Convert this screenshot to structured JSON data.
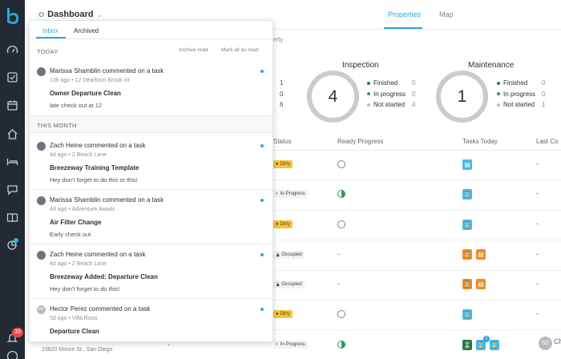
{
  "sidebar": {
    "logo": "breezeway-logo-icon",
    "icons": [
      "speedometer-icon",
      "checkbox-icon",
      "calendar-icon",
      "home-icon",
      "bed-icon",
      "chat-icon",
      "book-icon",
      "pie-chart-icon",
      "bell-icon",
      "help-icon"
    ],
    "notification_count": "33"
  },
  "header": {
    "title": "Dashboard",
    "tabs": [
      {
        "label": "Properties",
        "active": true
      },
      {
        "label": "Map",
        "active": false
      }
    ]
  },
  "main": {
    "partial_label": "erty",
    "left_stats": [
      "1",
      "0",
      "6"
    ],
    "inspection": {
      "title": "Inspection",
      "value": "4",
      "legend": [
        {
          "label": "Finished",
          "value": "0",
          "color": "#1f7a4b"
        },
        {
          "label": "In progress",
          "value": "0",
          "color": "#2e9b5c"
        },
        {
          "label": "Not started",
          "value": "4",
          "color": "#b6bcc2"
        }
      ]
    },
    "maintenance": {
      "title": "Maintenance",
      "value": "1",
      "legend": [
        {
          "label": "Finished",
          "value": "0",
          "color": "#1f7a4b"
        },
        {
          "label": "In progress",
          "value": "0",
          "color": "#2e9b5c"
        },
        {
          "label": "Not started",
          "value": "1",
          "color": "#b6bcc2"
        }
      ]
    },
    "table": {
      "headers": [
        "Status",
        "Ready Progress",
        "Tasks Today",
        "Last Co"
      ],
      "rows": [
        {
          "status": "Dirty",
          "progress": "none",
          "tasks": "-"
        },
        {
          "status": "In-Progress",
          "progress": "half",
          "tasks": "-"
        },
        {
          "status": "Dirty",
          "progress": "none",
          "tasks": "-"
        },
        {
          "status": "Occupied",
          "progress": "-",
          "tasks": "-"
        },
        {
          "status": "Occupied",
          "progress": "-",
          "tasks": "-"
        },
        {
          "status": "Dirty",
          "progress": "none",
          "tasks": "-"
        },
        {
          "status": "In-Progress",
          "progress": "half",
          "tasks": "Ch"
        }
      ],
      "task_sub_count": "2",
      "bottom_address": "23820 Moore St., San Diego",
      "bottom_prefix": "-",
      "avatar_initials": "SZ"
    }
  },
  "panel": {
    "tabs": [
      {
        "label": "Inbox",
        "active": true
      },
      {
        "label": "Archived",
        "active": false
      }
    ],
    "today_label": "TODAY",
    "archive_read": "Archive read",
    "mark_all_read": "Mark all as read",
    "this_month_label": "THIS MONTH",
    "notifications": [
      {
        "author": "Marissa Shamblin commented on a task",
        "meta": "13h ago • 12 Dearborn Brook cir",
        "title": "Owner Departure Clean",
        "body": "late check out at 12",
        "avatar": "",
        "unread": true
      },
      {
        "author": "Zach Heine commented on a task",
        "meta": "4d ago • 2 Beach Lane",
        "title": "Breezeway Training Template",
        "body": "Hey don't forget to do this or this!",
        "avatar": "",
        "unread": true
      },
      {
        "author": "Marissa Shamblin commented on a task",
        "meta": "4d ago • Adventure Awaits",
        "title": "Air Filter Change",
        "body": "Early check out",
        "avatar": "",
        "unread": true
      },
      {
        "author": "Zach Heine commented on a task",
        "meta": "4d ago • 2 Beach Lane",
        "title": "Breezeway Added: Departure Clean",
        "body": "Hey don't forget to do this!",
        "avatar": "",
        "unread": true
      },
      {
        "author": "Hector Perez commented on a task",
        "meta": "5d ago • Villa Rosa",
        "title": "Departure Clean",
        "body": "",
        "avatar": "HP",
        "unread": true
      }
    ]
  }
}
